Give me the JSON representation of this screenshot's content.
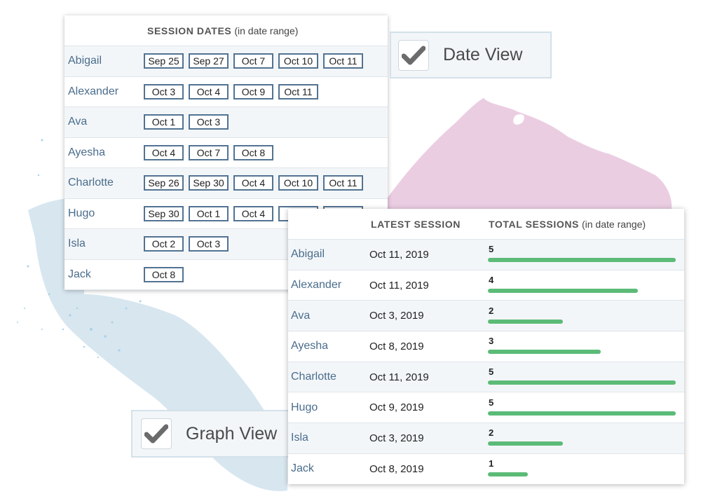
{
  "date_view": {
    "header_strong": "SESSION DATES",
    "header_light": "(in date range)",
    "rows": [
      {
        "name": "Abigail",
        "dates": [
          "Sep 25",
          "Sep 27",
          "Oct 7",
          "Oct 10",
          "Oct 11"
        ]
      },
      {
        "name": "Alexander",
        "dates": [
          "Oct 3",
          "Oct 4",
          "Oct 9",
          "Oct 11"
        ]
      },
      {
        "name": "Ava",
        "dates": [
          "Oct 1",
          "Oct 3"
        ]
      },
      {
        "name": "Ayesha",
        "dates": [
          "Oct 4",
          "Oct 7",
          "Oct 8"
        ]
      },
      {
        "name": "Charlotte",
        "dates": [
          "Sep 26",
          "Sep 30",
          "Oct 4",
          "Oct 10",
          "Oct 11"
        ]
      },
      {
        "name": "Hugo",
        "dates": [
          "Sep 30",
          "Oct 1",
          "Oct 4",
          "",
          ""
        ]
      },
      {
        "name": "Isla",
        "dates": [
          "Oct 2",
          "Oct 3"
        ]
      },
      {
        "name": "Jack",
        "dates": [
          "Oct 8"
        ]
      }
    ]
  },
  "badges": {
    "date_view_label": "Date View",
    "graph_view_label": "Graph View",
    "check_icon": "checkmark-icon",
    "check_color": "#6b6b6b"
  },
  "graph_view": {
    "header_latest": "LATEST SESSION",
    "header_total_strong": "TOTAL SESSIONS",
    "header_total_light": "(in date range)",
    "max_sessions": 5,
    "bar_color": "#5bbb77",
    "rows": [
      {
        "name": "Abigail",
        "latest": "Oct 11, 2019",
        "total": 5
      },
      {
        "name": "Alexander",
        "latest": "Oct 11, 2019",
        "total": 4
      },
      {
        "name": "Ava",
        "latest": "Oct 3, 2019",
        "total": 2
      },
      {
        "name": "Ayesha",
        "latest": "Oct 8, 2019",
        "total": 3
      },
      {
        "name": "Charlotte",
        "latest": "Oct 11, 2019",
        "total": 5
      },
      {
        "name": "Hugo",
        "latest": "Oct 9, 2019",
        "total": 5
      },
      {
        "name": "Isla",
        "latest": "Oct 3, 2019",
        "total": 2
      },
      {
        "name": "Jack",
        "latest": "Oct 8, 2019",
        "total": 1
      }
    ]
  },
  "colors": {
    "name_text": "#4a6d8c",
    "chip_border": "#527392",
    "pink_splash": "#ebcde2",
    "blue_splash": "#d7e6ef"
  }
}
